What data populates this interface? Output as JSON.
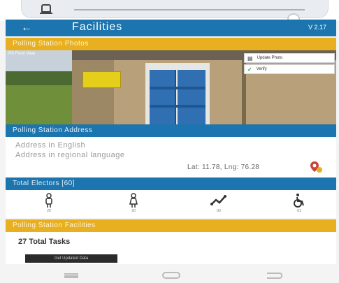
{
  "app_bar": {
    "back_icon": "arrow-left-icon",
    "title": "Facilities",
    "version": "V 2.17"
  },
  "photos_section": {
    "header": "Polling Station Photos",
    "photo_caption": "PS Front View",
    "update_photo_label": "Update Photo",
    "verify_label": "Verify"
  },
  "address_section": {
    "header": "Polling Station Address",
    "address_english": "Address in English",
    "address_regional": "Address in regional language",
    "lat_lng": "Lat: 11.78, Lng: 76.28",
    "map_icon": "map-pin-icon"
  },
  "electors_section": {
    "header": "Total Electors [60]",
    "items": [
      {
        "icon": "male-icon",
        "count": "20"
      },
      {
        "icon": "female-icon",
        "count": "20"
      },
      {
        "icon": "third-gender-icon",
        "count": "00"
      },
      {
        "icon": "wheelchair-icon",
        "count": "01"
      }
    ]
  },
  "facilities_section": {
    "header": "Polling Station Facilities",
    "total_tasks": "27 Total Tasks",
    "update_button": "Get Updated Data"
  },
  "colors": {
    "app_blue": "#1c75ae",
    "section_yellow": "#e8b020"
  }
}
